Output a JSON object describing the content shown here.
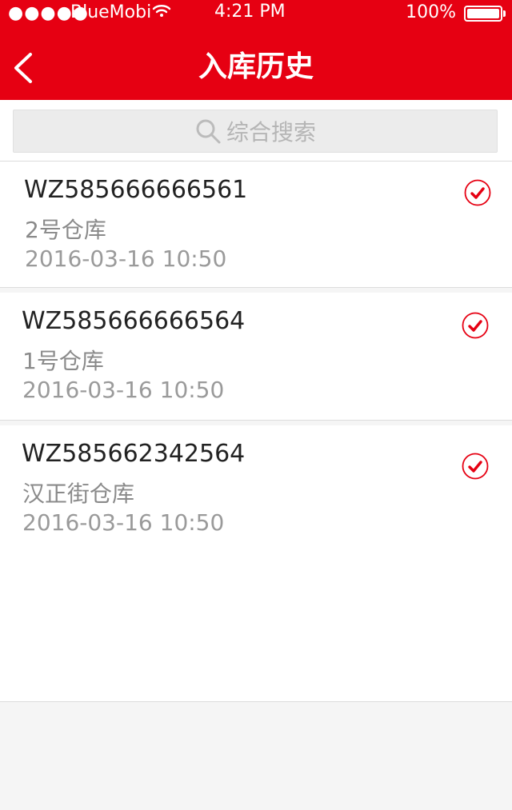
{
  "status_bar": {
    "signal": "●●●●●",
    "carrier": "BlueMobi",
    "time": "4:21 PM",
    "battery": "100%"
  },
  "header": {
    "title": "入库历史"
  },
  "search": {
    "placeholder": "综合搜索"
  },
  "records": [
    {
      "code": "WZ585666666561",
      "warehouse": "2号仓库",
      "datetime": "2016-03-16 10:50"
    },
    {
      "code": "WZ585666666564",
      "warehouse": "1号仓库",
      "datetime": "2016-03-16 10:50"
    },
    {
      "code": "WZ585662342564",
      "warehouse": "汉正街仓库",
      "datetime": "2016-03-16 10:50"
    }
  ],
  "colors": {
    "accent": "#e60012",
    "background": "#f5f5f5",
    "card": "#ffffff",
    "muted_text": "#8a8a8a"
  },
  "icons": {
    "back": "back-arrow-icon",
    "search": "search-icon",
    "wifi": "wifi-icon",
    "checked": "check-circle-icon"
  }
}
